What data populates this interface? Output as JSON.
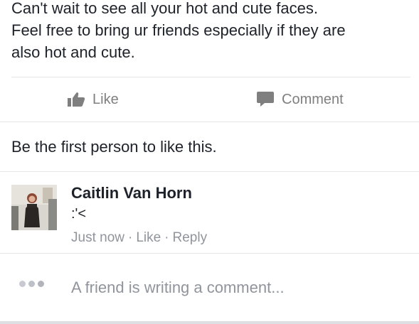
{
  "post": {
    "lines": [
      "Can't wait to see all your hot and cute faces.",
      "Feel free to bring ur friends especially if they are",
      "also hot and cute."
    ]
  },
  "actions": {
    "like_label": "Like",
    "like_icon": "thumbs-up-icon",
    "comment_label": "Comment",
    "comment_icon": "speech-bubble-icon",
    "icon_color": "#7f7f7f"
  },
  "likes_summary": "Be the first person to like this.",
  "comment": {
    "author": "Caitlin Van Horn",
    "text": ":'<",
    "time": "Just now",
    "like_label": "Like",
    "reply_label": "Reply",
    "separator": "·"
  },
  "typing_indicator": {
    "text": "A friend is writing a comment..."
  }
}
